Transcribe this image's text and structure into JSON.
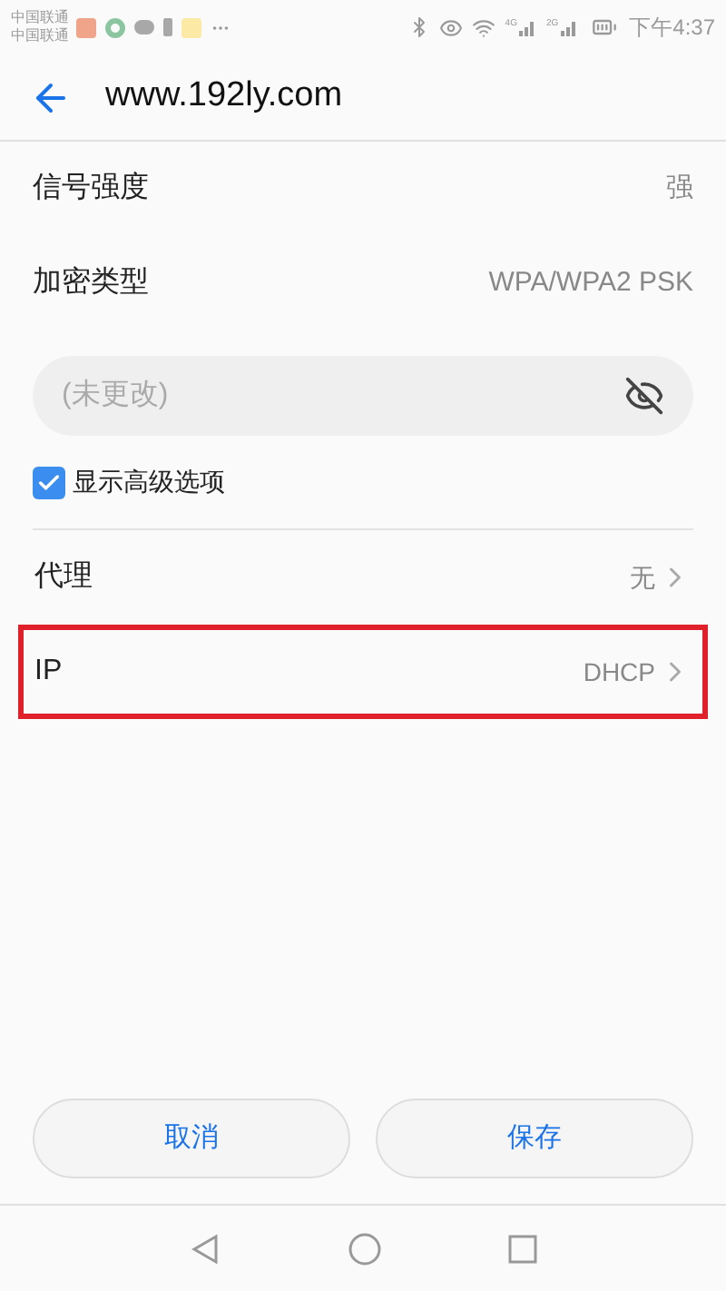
{
  "status_bar": {
    "carriers": [
      "中国联通",
      "中国联通"
    ],
    "network_labels": [
      "4G",
      "2G"
    ],
    "time": "下午4:37"
  },
  "header": {
    "title": "www.192ly.com"
  },
  "info_rows": [
    {
      "label": "信号强度",
      "value": "强"
    },
    {
      "label": "加密类型",
      "value": "WPA/WPA2 PSK"
    }
  ],
  "password_field": {
    "placeholder": "(未更改)",
    "visible": false
  },
  "advanced_option": {
    "label": "显示高级选项",
    "checked": true
  },
  "setting_rows": [
    {
      "label": "代理",
      "value": "无",
      "highlighted": false
    },
    {
      "label": "IP",
      "value": "DHCP",
      "highlighted": true
    }
  ],
  "buttons": [
    "取消",
    "保存"
  ]
}
